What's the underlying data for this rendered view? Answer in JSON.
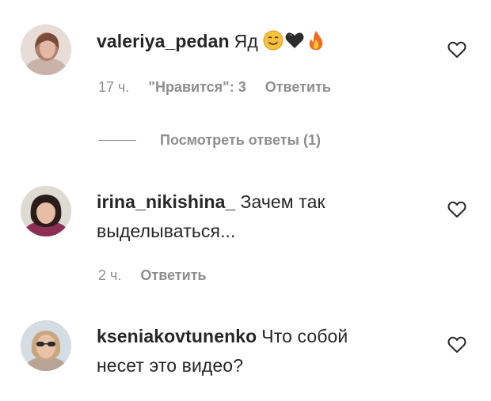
{
  "comments": [
    {
      "username": "valeriya_pedan",
      "text": "Яд",
      "emojis": [
        "smiling-face-icon",
        "black-heart-icon",
        "fire-icon"
      ],
      "time": "17 ч.",
      "likes": "\"Нравится\": 3",
      "reply": "Ответить"
    },
    {
      "username": "irina_nikishina_",
      "text": "Зачем так выделываться...",
      "time": "2 ч.",
      "reply": "Ответить"
    },
    {
      "username": "kseniakovtunenko",
      "text": "Что собой несет это видео?"
    }
  ],
  "view_replies": "Посмотреть ответы (1)",
  "colors": {
    "text": "#262626",
    "secondary": "#8e8e8e",
    "background": "#ffffff"
  }
}
